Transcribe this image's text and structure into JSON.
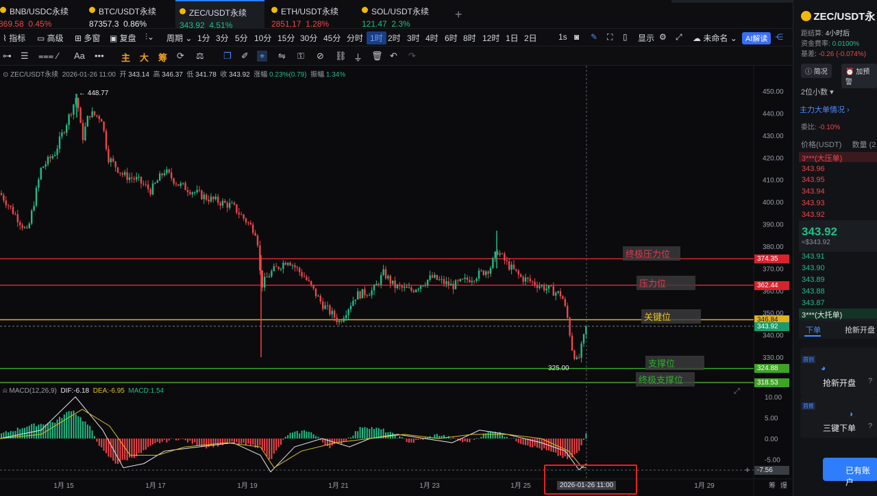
{
  "tabs": [
    {
      "name": "BNB/USDC永续",
      "price": "869.58",
      "change": "0.45%",
      "color": "red"
    },
    {
      "name": "BTC/USDT永续",
      "price": "87357.3",
      "change": "0.86%",
      "color": "white"
    },
    {
      "name": "ZEC/USDT永续",
      "price": "343.92",
      "change": "4.51%",
      "color": "green",
      "active": true
    },
    {
      "name": "ETH/USDT永续",
      "price": "2851.17",
      "change": "1.28%",
      "color": "red"
    },
    {
      "name": "SOL/USDT永续",
      "price": "121.47",
      "change": "2.3%",
      "color": "green"
    }
  ],
  "toolbar1": {
    "indicators": "指标",
    "advanced": "高级",
    "multi_window": "多窗",
    "replay": "复盘",
    "period": "周期",
    "intervals": [
      "1分",
      "3分",
      "5分",
      "10分",
      "15分",
      "30分",
      "45分",
      "分时",
      "1时",
      "2时",
      "3时",
      "4时",
      "6时",
      "8时",
      "12时",
      "1日",
      "2日"
    ],
    "selected_interval": "1时",
    "seconds": "1s",
    "display": "显示",
    "unnamed": "未命名",
    "ai": "AI解读"
  },
  "toolbar2": {
    "font_tool": "Aa",
    "more": "•••",
    "main": "主",
    "big": "大",
    "chip": "筹"
  },
  "ohlc": {
    "symbol": "ZEC/USDT永续",
    "datetime": "2026-01-26 11:00",
    "open_label": "开",
    "open": "343.14",
    "high_label": "高",
    "high": "346.37",
    "low_label": "低",
    "low": "341.78",
    "close_label": "收",
    "close": "343.92",
    "change_label": "涨幅",
    "change": "0.23%(0.79)",
    "amp_label": "振幅",
    "amp": "1.34%"
  },
  "macd": {
    "label": "MACD(12,26,9)",
    "dif": "DIF:-6.18",
    "dea": "DEA:-6.95",
    "macd": "MACD:1.54"
  },
  "price_axis": [
    "450.00",
    "440.00",
    "430.00",
    "420.00",
    "410.00",
    "400.00",
    "390.00",
    "380.00",
    "370.00",
    "360.00",
    "350.00",
    "340.00",
    "330.00"
  ],
  "macd_axis": [
    "10.00",
    "5.00",
    "0.00",
    "-5.00"
  ],
  "macd_cursor_value": "-7.56",
  "x_axis": [
    "1月 15",
    "1月 17",
    "1月 19",
    "1月 21",
    "1月 23",
    "1月 25",
    "1月 29"
  ],
  "x_axis_right": [
    "筹",
    "爆"
  ],
  "x_cursor_label": "2026-01-26 11:00",
  "annotations": {
    "high_marker": "← 448.77",
    "low_marker": "325.00"
  },
  "levels": [
    {
      "label": "终极压力位",
      "price": "374.35",
      "color": "#d8232f",
      "label_color": "#e8384a"
    },
    {
      "label": "压力位",
      "price": "362.44",
      "color": "#d8232f",
      "label_color": "#e8384a"
    },
    {
      "label": "关键位",
      "price": "346.84",
      "color": "#e0b31e",
      "label_color": "#f0c419"
    },
    {
      "label": "支撑位",
      "price": "324.88",
      "color": "#3fa326",
      "label_color": "#2fae2a"
    },
    {
      "label": "终极支撑位",
      "price": "318.53",
      "color": "#3fa326",
      "label_color": "#2fae2a"
    }
  ],
  "current_price_tag": "343.92",
  "right_panel": {
    "symbol": "ZEC/USDT永",
    "settle_label": "距结算:",
    "settle_value": "4小时后",
    "funding_label": "资金费率:",
    "funding_value": "0.0100%",
    "base_label": "基差",
    "base_value": "-0.26 (-0.074%)",
    "btn_intro": "简况",
    "btn_alert": "加预警",
    "decimals": "2位小数",
    "big_orders": "主力大单情况",
    "ratio_label": "委比:",
    "ratio_value": "-0.10%",
    "price_header": "价格(USDT)",
    "qty_header": "数量 (2",
    "big_sell": "3***(大压单)",
    "asks": [
      "343.96",
      "343.95",
      "343.94",
      "343.93",
      "343.92"
    ],
    "last_price": "343.92",
    "last_price_sub": "≈$343.92",
    "bids": [
      "343.91",
      "343.90",
      "343.89",
      "343.88",
      "343.87"
    ],
    "big_buy": "3***(大托单)",
    "tab_order": "下单",
    "tab_grab": "抢新开盘",
    "card1_tag": "首创",
    "card1_label": "抢新开盘",
    "card2_tag": "首推",
    "card2_label": "三键下单",
    "account_btn": "已有账户"
  },
  "colors": {
    "up": "#1fbf86",
    "down": "#f0464b",
    "accent": "#2e7dfc"
  }
}
